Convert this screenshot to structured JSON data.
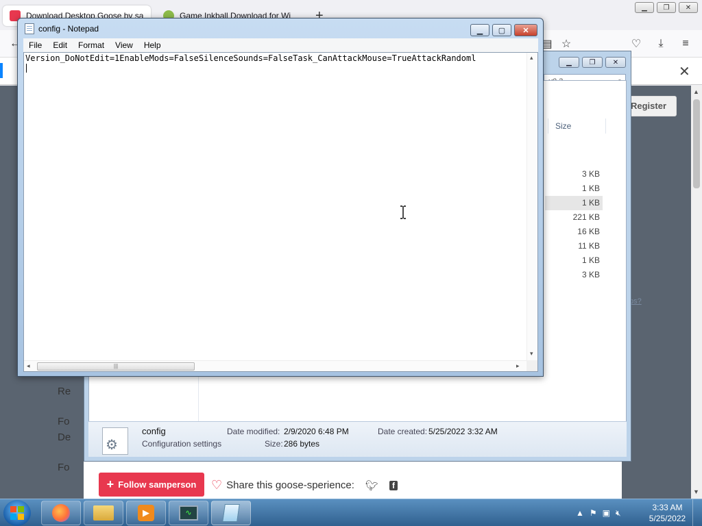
{
  "browser": {
    "tabs": [
      {
        "label": "Download Desktop Goose by sa"
      },
      {
        "label": "Game Inkball Download for Wi"
      }
    ],
    "register_label": "Register",
    "side_texts": [
      "Re",
      "Fo",
      "De",
      "Fo"
    ],
    "link_fragment": "ps?",
    "follow_label": "Follow samperson",
    "share_label": "Share this goose-sperience:"
  },
  "explorer": {
    "search_placeholder": "v0.3",
    "column_size": "Size",
    "sizes": [
      "3 KB",
      "1 KB",
      "1 KB",
      "221 KB",
      "16 KB",
      "11 KB",
      "1 KB",
      "3 KB"
    ],
    "details": {
      "file_name": "config",
      "file_type": "Configuration settings",
      "date_modified_label": "Date modified:",
      "date_modified_value": "2/9/2020 6:48 PM",
      "date_created_label": "Date created:",
      "date_created_value": "5/25/2022 3:32 AM",
      "size_label": "Size:",
      "size_value": "286 bytes"
    }
  },
  "notepad": {
    "title": "config - Notepad",
    "menu": [
      "File",
      "Edit",
      "Format",
      "View",
      "Help"
    ],
    "content": "Version_DoNotEdit=1EnableMods=FalseSilenceSounds=FalseTask_CanAttackMouse=TrueAttackRandoml"
  },
  "taskbar": {
    "time": "3:33 AM",
    "date": "5/25/2022"
  }
}
